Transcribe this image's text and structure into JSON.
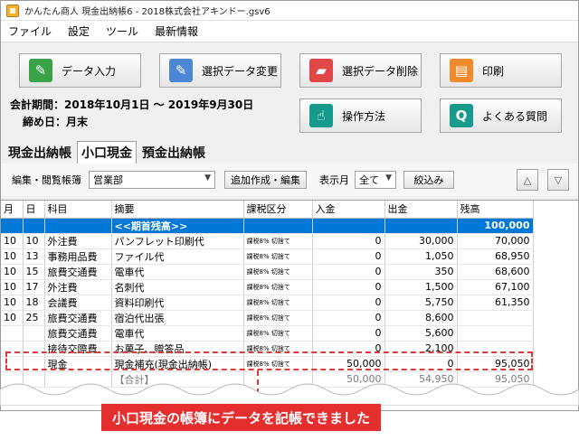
{
  "window": {
    "title": "かんたん商人 現金出納帳6 - 2018株式会社アキンドー.gsv6"
  },
  "menu": [
    "ファイル",
    "設定",
    "ツール",
    "最新情報"
  ],
  "toolbar": {
    "data_entry": "データ入力",
    "edit_data": "選択データ変更",
    "delete_data": "選択データ削除",
    "print": "印刷",
    "how_to": "操作方法",
    "faq": "よくある質問"
  },
  "period": {
    "label": "会計期間：2018年10月1日 〜 2019年9月30日",
    "closing": "締め日：月末"
  },
  "tabs": [
    "現金出納帳",
    "小口現金",
    "預金出納帳"
  ],
  "filter": {
    "book_label": "編集・閲覧帳簿",
    "book_value": "営業部",
    "add_edit": "追加作成・編集",
    "month_label": "表示月",
    "month_value": "全て",
    "narrow": "絞込み",
    "up": "△",
    "down": "▽"
  },
  "table": {
    "headers": [
      "月",
      "日",
      "科目",
      "摘要",
      "課税区分",
      "入金",
      "出金",
      "残高"
    ],
    "opening": {
      "summary": "<<期首残高>>",
      "balance": "100,000"
    },
    "rows": [
      [
        "10",
        "10",
        "外注費",
        "パンフレット印刷代",
        "課税8% 切捨て",
        "0",
        "30,000",
        "70,000"
      ],
      [
        "10",
        "13",
        "事務用品費",
        "ファイル代",
        "課税8% 切捨て",
        "0",
        "1,050",
        "68,950"
      ],
      [
        "10",
        "15",
        "旅費交通費",
        "電車代",
        "課税8% 切捨て",
        "0",
        "350",
        "68,600"
      ],
      [
        "10",
        "17",
        "外注費",
        "名刺代",
        "課税8% 切捨て",
        "0",
        "1,500",
        "67,100"
      ],
      [
        "10",
        "18",
        "会議費",
        "資料印刷代",
        "課税8% 切捨て",
        "0",
        "5,750",
        "61,350"
      ],
      [
        "10",
        "25",
        "旅費交通費",
        "宿泊代出張",
        "課税8% 切捨て",
        "0",
        "8,600",
        ""
      ],
      [
        "",
        "",
        "旅費交通費",
        "電車代",
        "課税8% 切捨て",
        "0",
        "5,600",
        ""
      ],
      [
        "",
        "",
        "接待交際費",
        "お菓子、贈答品",
        "課税8% 切捨て",
        "0",
        "2,100",
        ""
      ],
      [
        "",
        "",
        "現金",
        "現金補充(現金出納帳)",
        "課税8% 切捨て",
        "50,000",
        "0",
        "95,050"
      ],
      [
        "",
        "",
        "",
        "【合計】",
        "",
        "50,000",
        "54,950",
        "95,050"
      ]
    ]
  },
  "caption": "小口現金の帳簿にデータを記帳できました"
}
